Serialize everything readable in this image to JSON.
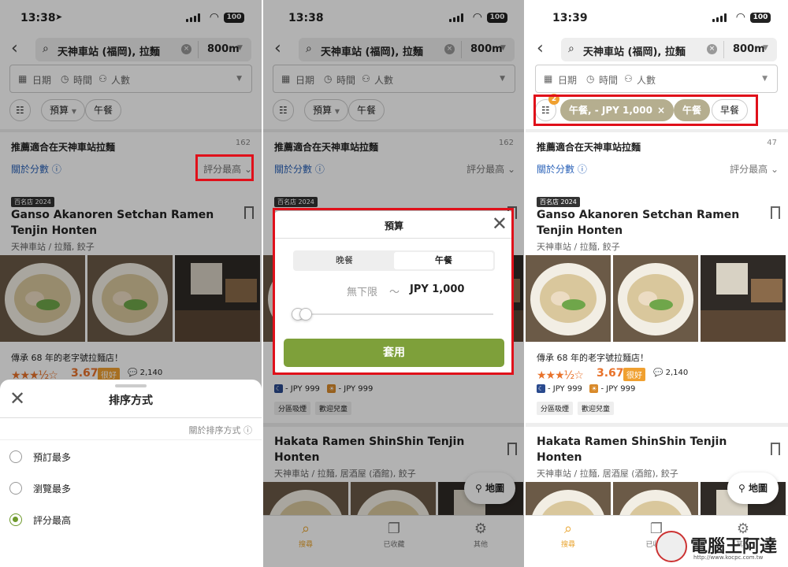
{
  "status": {
    "time1": "13:38",
    "time2": "13:38",
    "time3": "13:39",
    "battery": "100"
  },
  "search": {
    "query": "天神車站 (福岡), 拉麵",
    "distance": "800m"
  },
  "datebar": {
    "date": "日期",
    "time": "時間",
    "people": "人數"
  },
  "filters": {
    "settings_badge": "2",
    "budget": "預算",
    "lunch": "午餐",
    "lunch_budget": "午餐, - JPY 1,000",
    "breakfast": "早餐"
  },
  "results": {
    "heading": "推薦適合在天神車站拉麵",
    "count1": "162",
    "count2": "162",
    "count3": "47",
    "about_score": "關於分數",
    "sort_label": "評分最高"
  },
  "card1": {
    "badge": "百名店 2024",
    "title": "Ganso Akanoren Setchan Ramen Tenjin Honten",
    "subtitle": "天神車站 / 拉麵, 餃子",
    "desc": "傳承 68 年的老字號拉麵店！",
    "stars": "★★★½☆",
    "score": "3.67",
    "rating_word": "很好",
    "reviews": "2,140",
    "price_night": "- JPY 999",
    "price_lunch": "- JPY 999",
    "tags": [
      "分區吸煙",
      "歡迎兒童"
    ]
  },
  "card2": {
    "title": "Hakata Ramen ShinShin Tenjin Honten",
    "subtitle": "天神車站 / 拉麵, 居酒屋 (酒館), 餃子"
  },
  "map_button": "地圖",
  "tabs": {
    "search": "搜尋",
    "saved": "已收藏",
    "other": "其他"
  },
  "sort_sheet": {
    "title": "排序方式",
    "about_sort": "關於排序方式",
    "options": [
      "預訂最多",
      "瀏覽最多",
      "評分最高"
    ],
    "selected": "評分最高"
  },
  "budget_modal": {
    "title": "預算",
    "seg_dinner": "晚餐",
    "seg_lunch": "午餐",
    "min": "無下限",
    "tilde": "～",
    "max": "JPY 1,000",
    "apply": "套用"
  },
  "watermark": {
    "text": "電腦王阿達",
    "url": "http://www.kocpc.com.tw"
  },
  "colors": {
    "accent_green": "#7ea03a",
    "highlight_red": "#e0101a",
    "rating_orange": "#e8722a",
    "link_blue": "#2a62b8"
  }
}
